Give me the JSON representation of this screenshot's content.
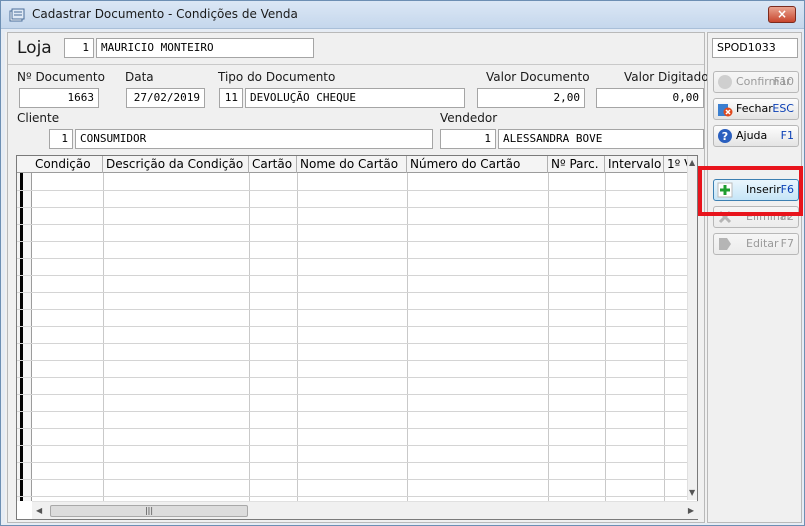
{
  "window": {
    "title": "Cadastrar Documento - Condições de Venda",
    "close_label": "×"
  },
  "loja": {
    "label": "Loja",
    "code": "1",
    "name": "MAURICIO MONTEIRO"
  },
  "screen_code": "SPOD1033",
  "documento": {
    "numero_label": "Nº Documento",
    "numero_value": "1663",
    "data_label": "Data",
    "data_value": "27/02/2019",
    "tipo_label": "Tipo do Documento",
    "tipo_code": "11",
    "tipo_name": "DEVOLUÇÃO CHEQUE",
    "valor_label": "Valor Documento",
    "valor_value": "2,00",
    "digitado_label": "Valor Digitado",
    "digitado_value": "0,00"
  },
  "cliente": {
    "label": "Cliente",
    "code": "1",
    "name": "CONSUMIDOR"
  },
  "vendedor": {
    "label": "Vendedor",
    "code": "1",
    "name": "ALESSANDRA BOVE"
  },
  "grid": {
    "columns": [
      "Condição",
      "Descrição da Condição",
      "Cartão",
      "Nome do Cartão",
      "Número do Cartão",
      "Nº Parc.",
      "Intervalo",
      "1º V"
    ],
    "rows": []
  },
  "buttons": {
    "confirmar": {
      "label": "Confirmar",
      "key": "F10"
    },
    "fechar": {
      "label": "Fechar",
      "key": "ESC"
    },
    "ajuda": {
      "label": "Ajuda",
      "key": "F1"
    },
    "inserir": {
      "label": "Inserir",
      "key": "F6"
    },
    "eliminar": {
      "label": "Eliminar",
      "key": "F2"
    },
    "editar": {
      "label": "Editar",
      "key": "F7"
    }
  },
  "colors": {
    "highlight": "#e8141c",
    "key_text": "#0a3fb5"
  }
}
